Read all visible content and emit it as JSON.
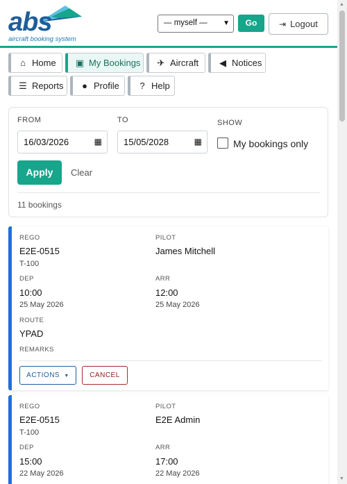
{
  "header": {
    "logo_text": "abs",
    "logo_tagline": "aircraft booking system",
    "user_select_value": "— myself —",
    "go_label": "Go",
    "logout_label": "Logout"
  },
  "nav": {
    "items": [
      {
        "label": "Home",
        "icon": "home-icon"
      },
      {
        "label": "My Bookings",
        "icon": "calendar-check-icon"
      },
      {
        "label": "Aircraft",
        "icon": "plane-icon"
      },
      {
        "label": "Notices",
        "icon": "megaphone-icon"
      },
      {
        "label": "Reports",
        "icon": "list-icon"
      },
      {
        "label": "Profile",
        "icon": "user-circle-icon"
      },
      {
        "label": "Help",
        "icon": "question-circle-icon"
      }
    ],
    "active": "My Bookings"
  },
  "filter": {
    "from_label": "FROM",
    "from_value": "16/03/2026",
    "to_label": "TO",
    "to_value": "15/05/2028",
    "show_label": "SHOW",
    "my_bookings_only_label": "My bookings only",
    "my_bookings_only_checked": false,
    "apply_label": "Apply",
    "clear_label": "Clear",
    "count_text": "11 bookings"
  },
  "bookings": [
    {
      "rego_label": "REGO",
      "rego": "E2E-0515",
      "aircraft_type": "T-100",
      "pilot_label": "PILOT",
      "pilot": "James Mitchell",
      "dep_label": "DEP",
      "dep_time": "10:00",
      "dep_date": "25 May 2026",
      "arr_label": "ARR",
      "arr_time": "12:00",
      "arr_date": "25 May 2026",
      "route_label": "ROUTE",
      "route": "YPAD",
      "remarks_label": "REMARKS",
      "remarks": "",
      "actions_label": "ACTIONS",
      "cancel_label": "CANCEL"
    },
    {
      "rego_label": "REGO",
      "rego": "E2E-0515",
      "aircraft_type": "T-100",
      "pilot_label": "PILOT",
      "pilot": "E2E Admin",
      "dep_label": "DEP",
      "dep_time": "15:00",
      "dep_date": "22 May 2026",
      "arr_label": "ARR",
      "arr_time": "17:00",
      "arr_date": "22 May 2026"
    }
  ],
  "colors": {
    "accent": "#17a58c",
    "brand_blue": "#1f5d9a",
    "booking_border": "#1e6fe0",
    "cancel_red": "#a52a2a"
  }
}
